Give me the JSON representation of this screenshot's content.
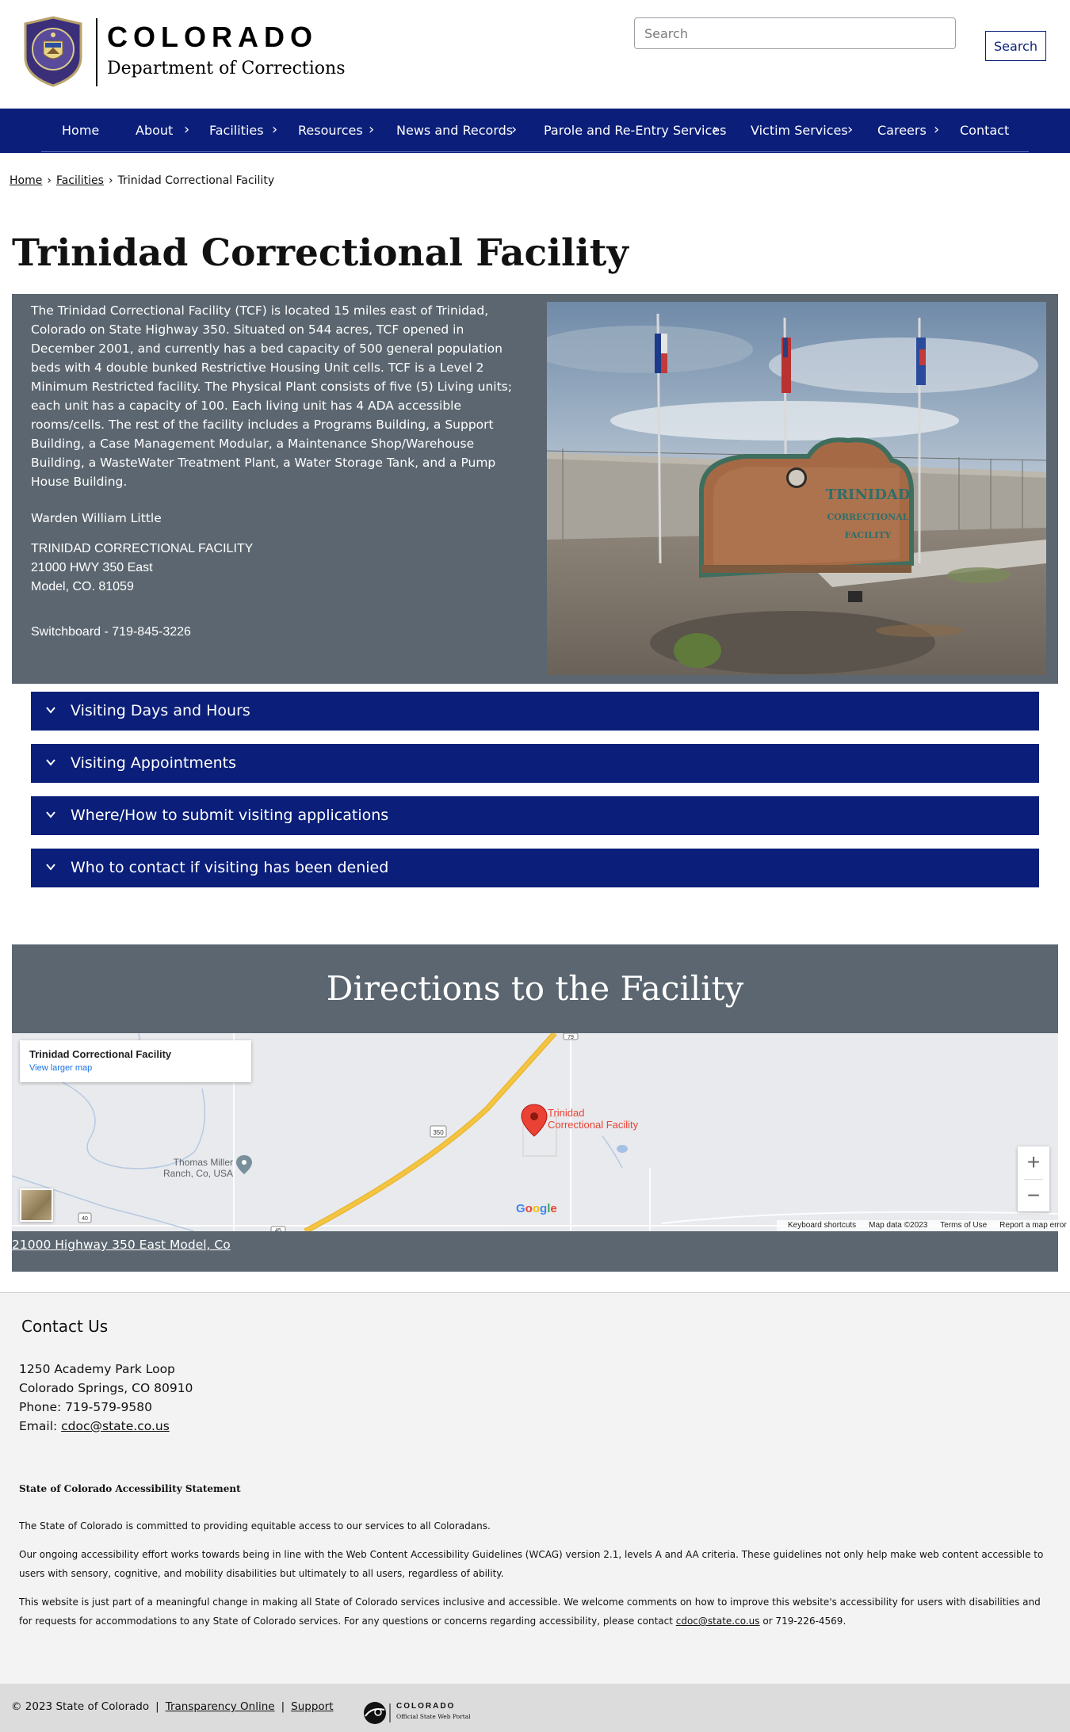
{
  "header": {
    "brand_title": "COLORADO",
    "brand_subtitle": "Department of Corrections",
    "search_placeholder": "Search",
    "search_button": "Search"
  },
  "nav": {
    "items": [
      {
        "label": "Home",
        "has_submenu": false
      },
      {
        "label": "About",
        "has_submenu": true
      },
      {
        "label": "Facilities",
        "has_submenu": true
      },
      {
        "label": "Resources",
        "has_submenu": true
      },
      {
        "label": "News and Records",
        "has_submenu": true
      },
      {
        "label": "Parole and Re-Entry Services",
        "has_submenu": true
      },
      {
        "label": "Victim Services",
        "has_submenu": true
      },
      {
        "label": "Careers",
        "has_submenu": true
      },
      {
        "label": "Contact",
        "has_submenu": false
      }
    ],
    "chevron": "›"
  },
  "breadcrumb": {
    "items": [
      "Home",
      "Facilities",
      "Trinidad Correctional Facility"
    ],
    "separator": "›"
  },
  "page": {
    "title": "Trinidad Correctional Facility",
    "description": "The Trinidad Correctional Facility (TCF) is located 15 miles east of Trinidad, Colorado on State Highway 350.  Situated on 544 acres, TCF opened in December 2001, and currently has a bed capacity of 500 general population beds with 4 double bunked Restrictive Housing Unit cells.  TCF is a Level 2 Minimum Restricted facility.  The Physical Plant consists of five (5) Living units; each unit has a capacity of 100.  Each living unit has 4 ADA accessible rooms/cells.  The rest of the facility includes a Programs Building, a Support Building, a Case Management Modular, a Maintenance Shop/Warehouse Building, a WasteWater Treatment Plant, a Water Storage Tank, and a Pump House Building.",
    "warden": "Warden William Little",
    "address_lines": [
      "TRINIDAD CORRECTIONAL FACILITY",
      "21000 HWY 350 East",
      "Model, CO. 81059"
    ],
    "switchboard": "Switchboard - 719-845-3226",
    "photo_sign_text": [
      "TRINIDAD",
      "CORRECTIONAL",
      "FACILITY"
    ]
  },
  "accordions": [
    {
      "label": "Visiting Days and Hours"
    },
    {
      "label": "Visiting Appointments"
    },
    {
      "label": "Where/How to submit visiting applications"
    },
    {
      "label": "Who to contact if visiting has been denied"
    }
  ],
  "directions": {
    "title": "Directions to the Facility",
    "map": {
      "card_title": "Trinidad Correctional Facility",
      "card_link": "View larger map",
      "marker_label": [
        "Trinidad",
        "Correctional Facility"
      ],
      "place_label": [
        "Thomas Miller",
        "Ranch, Co, USA"
      ],
      "route_shields": [
        "350",
        "40",
        "79",
        "45"
      ],
      "zoom_in": "+",
      "zoom_out": "−",
      "attribution": [
        "Keyboard shortcuts",
        "Map data ©2023",
        "Terms of Use",
        "Report a map error"
      ],
      "logo_letters": [
        "G",
        "o",
        "o",
        "g",
        "l",
        "e"
      ]
    },
    "address_link": "21000 Highway 350 East Model, Co"
  },
  "contact": {
    "title": "Contact Us",
    "address1": "1250 Academy Park Loop",
    "address2": "Colorado Springs, CO 80910",
    "phone": "Phone: 719-579-9580",
    "email_label": "Email: ",
    "email": "cdoc@state.co.us"
  },
  "accessibility": {
    "title": "State of Colorado Accessibility Statement",
    "p1": "The State of Colorado is committed to providing equitable access to our services to all Coloradans.",
    "p2": "Our ongoing accessibility effort works towards being in line with the Web Content Accessibility Guidelines (WCAG) version 2.1, levels A and AA criteria. These guidelines not only help make web content accessible to users with sensory, cognitive, and mobility disabilities but ultimately to all users, regardless of ability.",
    "p3_before": "This website is just part of a meaningful change in making all State of Colorado services inclusive and accessible. We welcome comments on how to improve this website's accessibility for users with disabilities and for requests for accommodations to any State of Colorado services. For any questions or concerns regarding accessibility, please contact ",
    "p3_email": "cdoc@state.co.us",
    "p3_after": " or 719-226-4569."
  },
  "footer": {
    "copyright": "© 2023 State of Colorado",
    "separator": "|",
    "links": [
      "Transparency Online",
      "Support"
    ],
    "portal_name": "COLORADO",
    "portal_sub": "Official State Web Portal"
  },
  "colors": {
    "nav_blue": "#0a1e7a",
    "panel_gray": "#5b6670",
    "footer_gray": "#dcdcdc",
    "map_marker": "#ea4335",
    "highway": "#f5c542"
  }
}
